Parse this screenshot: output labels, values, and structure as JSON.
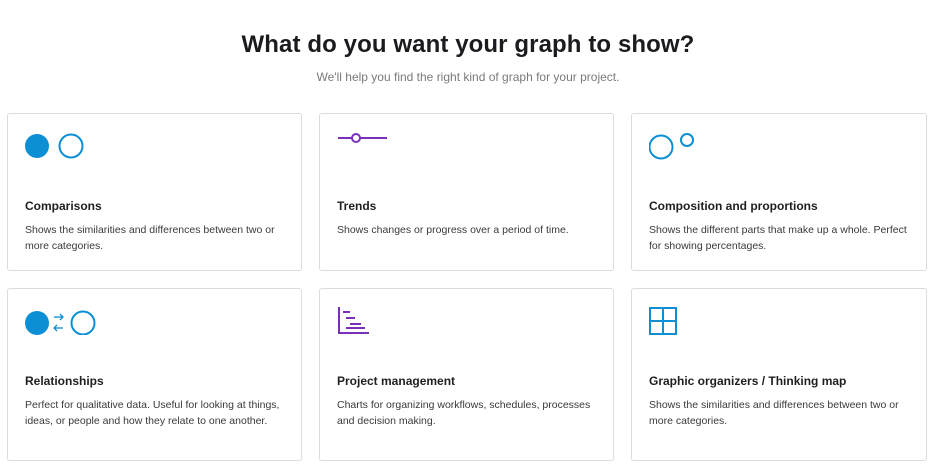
{
  "header": {
    "title": "What do you want your graph to show?",
    "subtitle": "We'll help you find the right kind of graph for your project."
  },
  "colors": {
    "blue": "#0d8fd6",
    "purple": "#7a2fb8"
  },
  "cards": [
    {
      "icon": "comparison-circles-icon",
      "title": "Comparisons",
      "description": "Shows the similarities and differences between two or more categories."
    },
    {
      "icon": "trend-line-icon",
      "title": "Trends",
      "description": "Shows changes or progress over a period of time."
    },
    {
      "icon": "composition-circles-icon",
      "title": "Composition and proportions",
      "description": "Shows the different parts that make up a whole. Perfect for showing percentages."
    },
    {
      "icon": "relationship-arrows-icon",
      "title": "Relationships",
      "description": "Perfect for qualitative data. Useful for looking at things, ideas, or people and how they relate to one another."
    },
    {
      "icon": "gantt-chart-icon",
      "title": "Project management",
      "description": "Charts for organizing workflows, schedules, processes and decision making."
    },
    {
      "icon": "grid-organizer-icon",
      "title": "Graphic organizers / Thinking map",
      "description": "Shows the similarities and differences between two or more categories."
    }
  ]
}
